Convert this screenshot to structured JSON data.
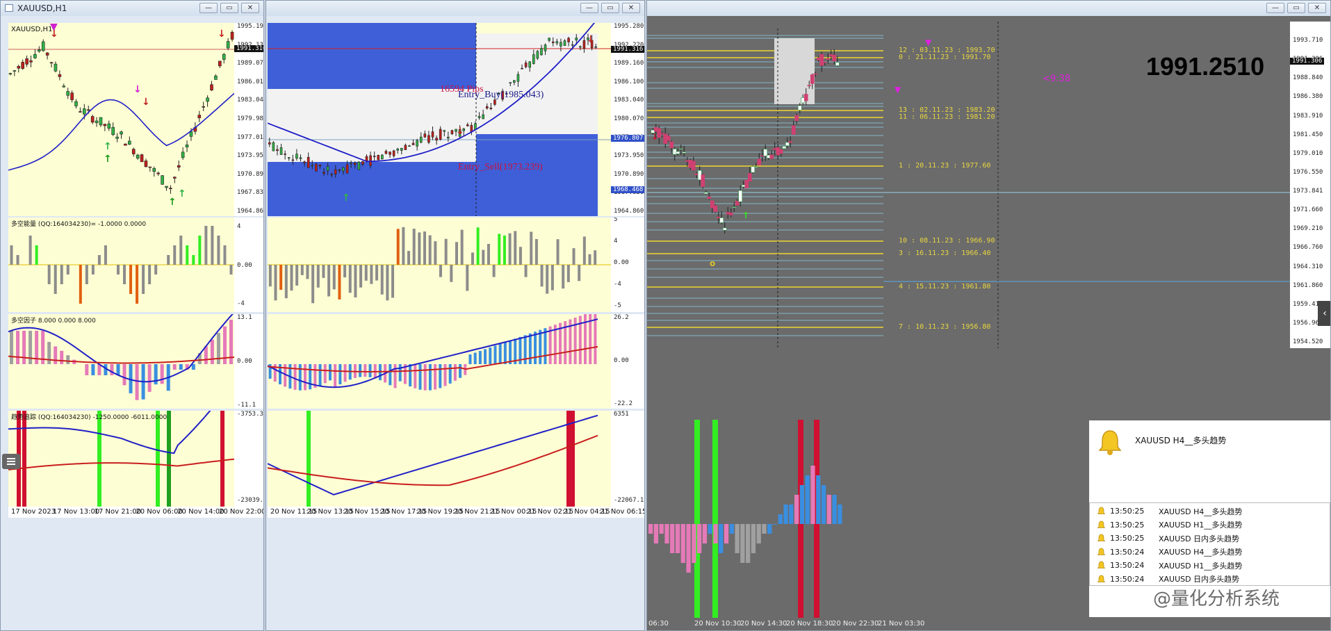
{
  "window1": {
    "title": "XAUUSD,H1",
    "symbol_label": "XAUUSD,H1",
    "price_ticks": [
      "1995.190",
      "1992.130",
      "1989.070",
      "1986.010",
      "1983.040",
      "1979.980",
      "1977.010",
      "1973.950",
      "1970.890",
      "1967.830",
      "1964.860"
    ],
    "current_price": "1991.316",
    "ind1_label": "多空能量 (QQ:164034230)= -1.0000 0.0000",
    "ind1_ticks": [
      "4",
      "0.00",
      "-4"
    ],
    "ind2_label": "多空因子 8.000 0.000 8.000",
    "ind2_ticks": [
      "13.1",
      "0.00",
      "-11.1"
    ],
    "ind3_label": "趋势追踪 (QQ:164034230) -1250.0000 -6011.0000",
    "ind3_ticks": [
      "-3753.35",
      "-23039.65"
    ],
    "time_labels": [
      "17 Nov 2023",
      "17 Nov 13:00",
      "17 Nov 21:00",
      "20 Nov 06:00",
      "20 Nov 14:00",
      "20 Nov 22:00"
    ]
  },
  "window2": {
    "price_ticks": [
      "1995.280",
      "1992.220",
      "1989.160",
      "1986.100",
      "1983.040",
      "1980.070",
      "1977.010",
      "1973.950",
      "1970.890",
      "1967.830",
      "1964.860"
    ],
    "current_price": "1991.316",
    "marker_prices": [
      "1976.807",
      "1968.468"
    ],
    "annotations": {
      "pips": "16594 Pips",
      "entry_buy": "Entry_Buy(1985.043)",
      "entry_sell": "Entry_Sell(1973.239)"
    },
    "ind1_ticks": [
      "5",
      "4",
      "0.00",
      "-4",
      "-5"
    ],
    "ind2_ticks": [
      "26.2",
      "0.00",
      "-22.2"
    ],
    "ind3_ticks": [
      "6351",
      "-22067.1"
    ],
    "time_labels": [
      "20 Nov 11:15",
      "20 Nov 13:15",
      "20 Nov 15:15",
      "20 Nov 17:15",
      "20 Nov 19:15",
      "20 Nov 21:15",
      "21 Nov 00:15",
      "21 Nov 02:15",
      "21 Nov 04:15",
      "21 Nov 06:15"
    ]
  },
  "window3": {
    "big_price": "1991.2510",
    "countdown": "<9:38",
    "price_ticks": [
      "1993.710",
      "1991.306",
      "1988.840",
      "1986.380",
      "1983.910",
      "1981.450",
      "1979.010",
      "1976.550",
      "1973.841",
      "1971.660",
      "1969.210",
      "1966.760",
      "1964.310",
      "1961.860",
      "1959.410",
      "1956.960",
      "1954.520"
    ],
    "current_price": "1991.306",
    "levels": [
      "12 : 03.11.23 : 1993.70",
      "0 : 21.11.23 : 1991.70",
      "13 : 02.11.23 : 1983.20",
      "11 : 06.11.23 : 1981.20",
      "1 : 20.11.23 : 1977.60",
      "10 : 08.11.23 : 1966.90",
      "3 : 16.11.23 : 1966.40",
      "4 : 15.11.23 : 1961.80",
      "7 : 10.11.23 : 1956.80"
    ],
    "time_labels": [
      "06:30",
      "20 Nov 10:30",
      "20 Nov 14:30",
      "20 Nov 18:30",
      "20 Nov 22:30",
      "21 Nov 03:30"
    ]
  },
  "alert": {
    "headline": "XAUUSD  H4__多头趋势",
    "rows": [
      {
        "time": "13:50:25",
        "text": "XAUUSD  H4__多头趋势"
      },
      {
        "time": "13:50:25",
        "text": "XAUUSD  H1__多头趋势"
      },
      {
        "time": "13:50:25",
        "text": "XAUUSD  日内多头趋势"
      },
      {
        "time": "13:50:24",
        "text": "XAUUSD  H4__多头趋势"
      },
      {
        "time": "13:50:24",
        "text": "XAUUSD  H1__多头趋势"
      },
      {
        "time": "13:50:24",
        "text": "XAUUSD  日内多头趋势"
      }
    ]
  },
  "watermark": "@量化分析系统",
  "colors": {
    "chart_bg": "#fefed4",
    "dark_bg": "#6b6b6b",
    "up": "#31b247",
    "down": "#c0201c",
    "ma_blue": "#1f1fc8",
    "ma_red": "#c81e1e",
    "zone_blue": "#3f5fd8",
    "bar_blue": "#3a8ee0",
    "bar_pink": "#e57ab8",
    "bar_gray": "#a0a0a0",
    "green_hl": "#33ee22",
    "red_hl": "#d01030"
  }
}
